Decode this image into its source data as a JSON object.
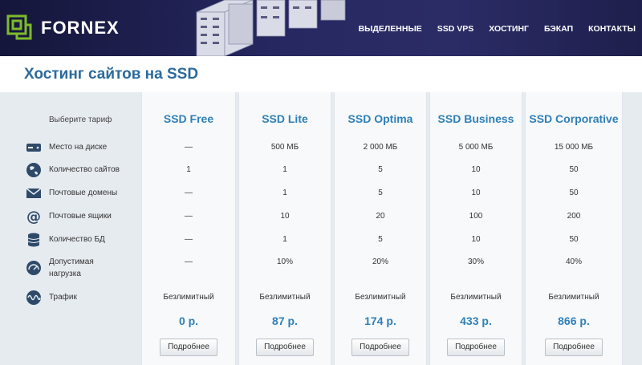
{
  "header": {
    "brand": "FORNEX",
    "nav": [
      "ВЫДЕЛЕННЫЕ",
      "SSD VPS",
      "ХОСТИНГ",
      "БЭКАП",
      "КОНТАКТЫ"
    ]
  },
  "page_title": "Хостинг сайтов на SSD",
  "table": {
    "choose_label": "Выберите тариф",
    "features": [
      {
        "icon": "disk-icon",
        "label": "Место на диске"
      },
      {
        "icon": "globe-icon",
        "label": "Количество сайтов"
      },
      {
        "icon": "envelope-icon",
        "label": "Почтовые домены"
      },
      {
        "icon": "at-icon",
        "label": "Почтовые ящики"
      },
      {
        "icon": "database-icon",
        "label": "Количество БД"
      },
      {
        "icon": "gauge-icon",
        "label_line1": "Допустимая",
        "label_line2": "нагрузка"
      },
      {
        "icon": "wave-icon",
        "label": "Трафик"
      }
    ],
    "plans": [
      {
        "name": "SSD Free",
        "values": [
          "—",
          "1",
          "—",
          "—",
          "—",
          "—",
          "Безлимитный"
        ],
        "price": "0 р.",
        "button": "Подробнее"
      },
      {
        "name": "SSD Lite",
        "values": [
          "500 МБ",
          "1",
          "1",
          "10",
          "1",
          "10%",
          "Безлимитный"
        ],
        "price": "87 р.",
        "button": "Подробнее"
      },
      {
        "name": "SSD Optima",
        "values": [
          "2 000 МБ",
          "5",
          "5",
          "20",
          "5",
          "20%",
          "Безлимитный"
        ],
        "price": "174 р.",
        "button": "Подробнее"
      },
      {
        "name": "SSD Business",
        "values": [
          "5 000 МБ",
          "10",
          "10",
          "100",
          "10",
          "30%",
          "Безлимитный"
        ],
        "price": "433 р.",
        "button": "Подробнее"
      },
      {
        "name": "SSD Corporative",
        "values": [
          "15 000 МБ",
          "50",
          "50",
          "200",
          "50",
          "40%",
          "Безлимитный"
        ],
        "price": "866 р.",
        "button": "Подробнее"
      }
    ]
  },
  "colors": {
    "header_bg": "#272862",
    "accent": "#2f7fb7",
    "title": "#2b6a9c",
    "logo": "#7dbb2b"
  }
}
